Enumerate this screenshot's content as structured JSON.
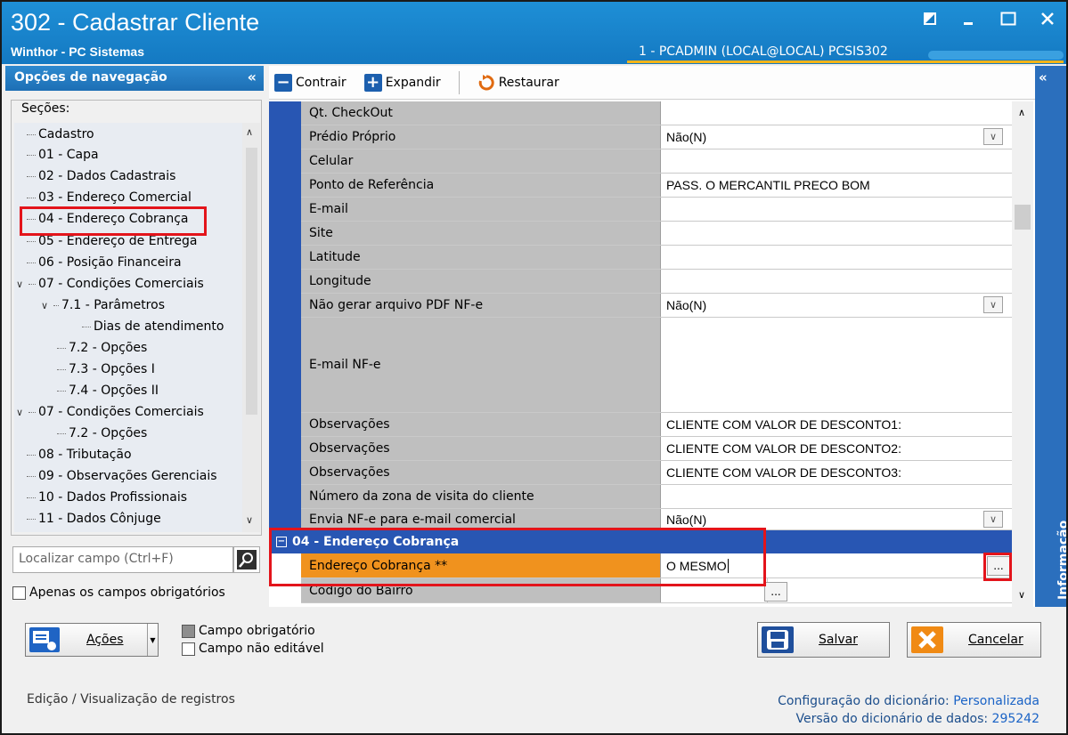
{
  "window": {
    "title": "302 - Cadastrar Cliente",
    "subtitle": "Winthor - PC Sistemas",
    "user_info": "1 - PCADMIN (LOCAL@LOCAL)   PCSIS302"
  },
  "nav": {
    "header": "Opções de navegação",
    "collapse": "«",
    "sections_label": "Seções:",
    "items": [
      {
        "label": "Cadastro",
        "level": 0
      },
      {
        "label": "01 - Capa",
        "level": 0
      },
      {
        "label": "02 - Dados Cadastrais",
        "level": 0
      },
      {
        "label": "03 - Endereço Comercial",
        "level": 0
      },
      {
        "label": "04 - Endereço Cobrança",
        "level": 0,
        "selected": true
      },
      {
        "label": "05 - Endereço de Entrega",
        "level": 0
      },
      {
        "label": "06 - Posição Financeira",
        "level": 0
      },
      {
        "label": "07 - Condições Comerciais",
        "level": 0,
        "expanded": true
      },
      {
        "label": "7.1 - Parâmetros",
        "level": 1,
        "expanded": true
      },
      {
        "label": "Dias de atendimento",
        "level": 2
      },
      {
        "label": "7.2 - Opções",
        "level": 1
      },
      {
        "label": "7.3 - Opções I",
        "level": 1
      },
      {
        "label": "7.4 - Opções II",
        "level": 1
      },
      {
        "label": "07 - Condições Comerciais",
        "level": 0,
        "expanded": true
      },
      {
        "label": "7.2 - Opções",
        "level": 1
      },
      {
        "label": "08 - Tributação",
        "level": 0
      },
      {
        "label": "09 - Observações Gerenciais",
        "level": 0
      },
      {
        "label": "10 - Dados Profissionais",
        "level": 0
      },
      {
        "label": "11 - Dados Cônjuge",
        "level": 0
      }
    ],
    "search_placeholder": "Localizar campo (Ctrl+F)",
    "only_required": "Apenas os campos obrigatórios"
  },
  "toolbar": {
    "collapse": "Contrair",
    "expand": "Expandir",
    "restore": "Restaurar"
  },
  "grid": {
    "rows": [
      {
        "label": "Qt. CheckOut",
        "value": ""
      },
      {
        "label": "Prédio Próprio",
        "value": "Não(N)",
        "dropdown": true
      },
      {
        "label": "Celular",
        "value": ""
      },
      {
        "label": "Ponto de Referência",
        "value": "PASS. O MERCANTIL PRECO BOM"
      },
      {
        "label": "E-mail",
        "value": ""
      },
      {
        "label": "Site",
        "value": ""
      },
      {
        "label": "Latitude",
        "value": ""
      },
      {
        "label": "Longitude",
        "value": ""
      },
      {
        "label": "Não gerar arquivo PDF NF-e",
        "value": "Não(N)",
        "dropdown": true
      },
      {
        "label": "E-mail NF-e",
        "value": "",
        "tall": true
      },
      {
        "label": "Observações",
        "value": "CLIENTE COM VALOR DE DESCONTO1:"
      },
      {
        "label": "Observações",
        "value": "CLIENTE COM VALOR DE DESCONTO2:"
      },
      {
        "label": "Observações",
        "value": "CLIENTE COM VALOR DE DESCONTO3:"
      },
      {
        "label": "Número da zona de visita do cliente",
        "value": ""
      },
      {
        "label": "Envia NF-e para e-mail comercial",
        "value": "Não(N)",
        "dropdown": true
      }
    ],
    "section_title": "04 - Endereço Cobrança",
    "cobranca_label": "Endereço Cobrança **",
    "cobranca_value": "O MESMO",
    "bairro_label": "Código do Bairro",
    "bairro_value": "",
    "ellipsis": "..."
  },
  "info_strip": {
    "label": "Informação",
    "arrows": "«"
  },
  "actions": {
    "acoes": "Ações",
    "legend_required": "Campo obrigatório",
    "legend_readonly": "Campo não editável",
    "save": "Salvar",
    "cancel": "Cancelar"
  },
  "footer": {
    "mode": "Edição / Visualização de registros",
    "dict_config_label": "Configuração do dicionário:",
    "dict_config_value": "Personalizada",
    "dict_version_label": "Versão do dicionário de dados:",
    "dict_version_value": "295242"
  },
  "colors": {
    "title_bar": "#1479c2",
    "grid_gutter": "#2856b3",
    "required_row": "#f0921e",
    "highlight": "#e3141b"
  }
}
